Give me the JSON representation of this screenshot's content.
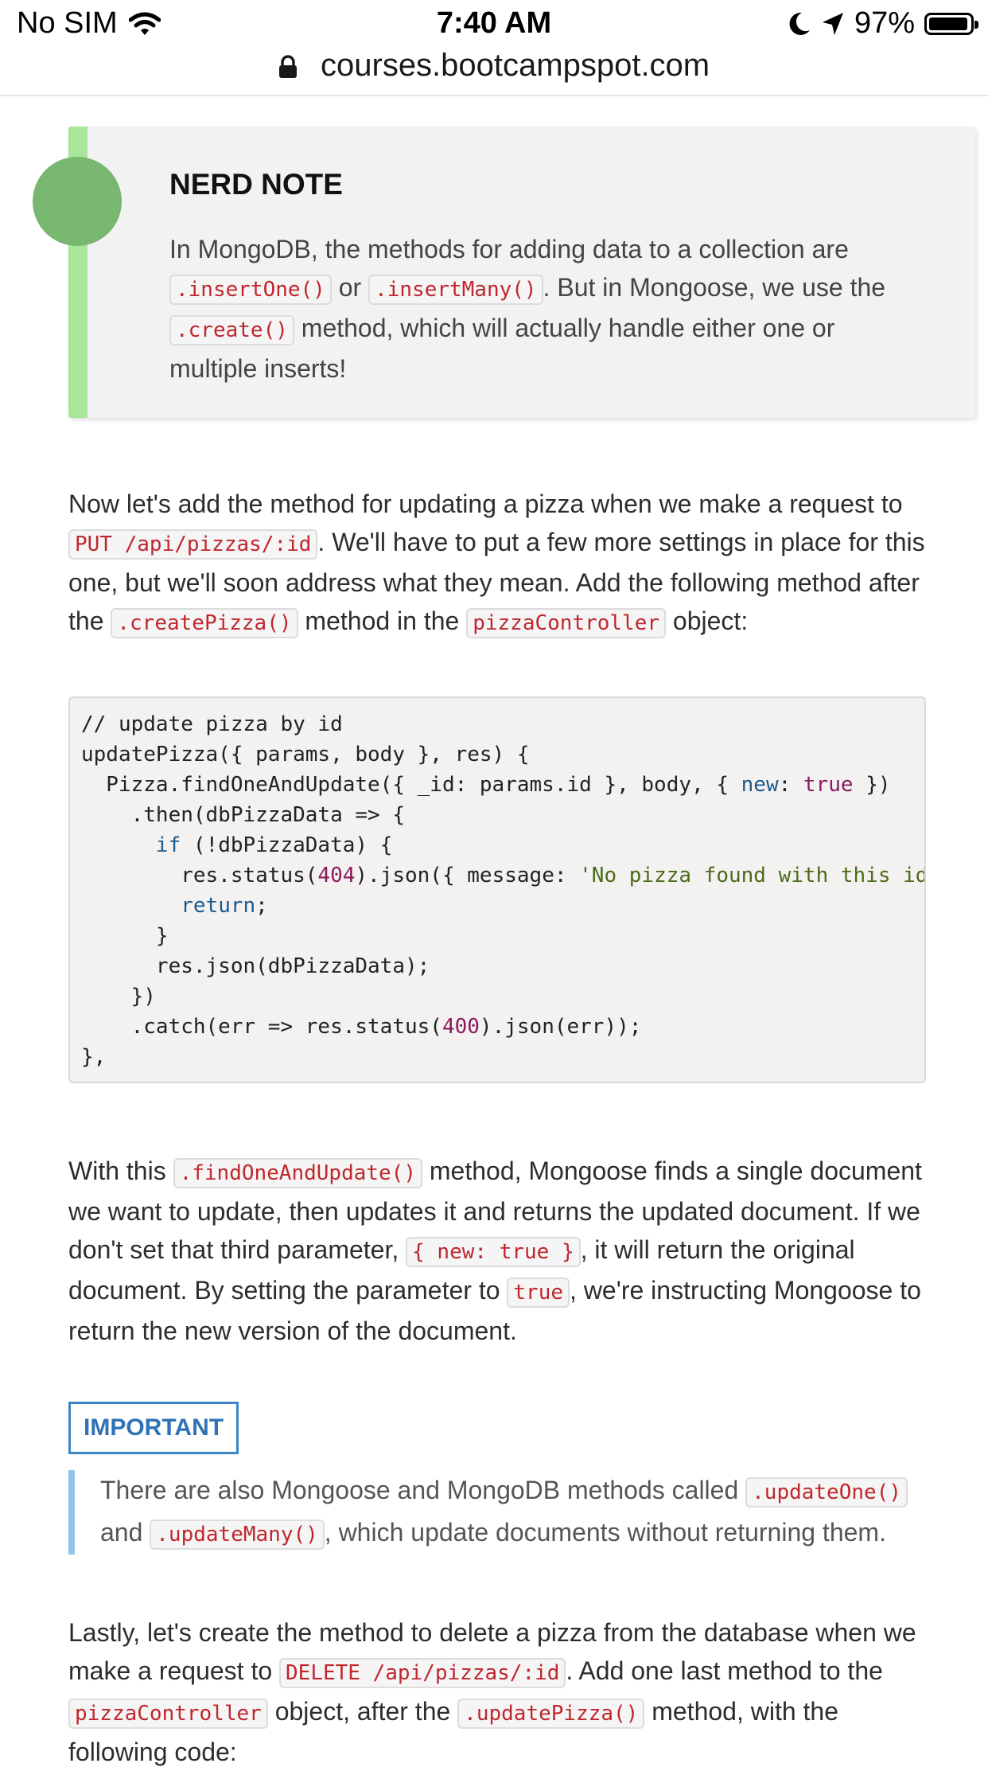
{
  "status": {
    "carrier": "No SIM",
    "time": "7:40 AM",
    "battery": "97%",
    "battery_level": 0.97
  },
  "browser": {
    "url": "courses.bootcampspot.com"
  },
  "nerd_note": {
    "title": "NERD NOTE",
    "t1": "In MongoDB, the methods for adding data to a collection are ",
    "c1": ".insertOne()",
    "t2": " or ",
    "c2": ".insertMany()",
    "t3": ". But in Mongoose, we use the ",
    "c3": ".create()",
    "t4": " method, which will actually handle either one or multiple inserts!"
  },
  "para1": {
    "t1": "Now let's add the method for updating a pizza when we make a request to ",
    "c1": "PUT /api/pizzas/:id",
    "t2": ". We'll have to put a few more settings in place for this one, but we'll soon address what they mean. Add the following method after the ",
    "c2": ".createPizza()",
    "t3": " method in the ",
    "c3": "pizzaController",
    "t4": " object:"
  },
  "code": {
    "l1": "// update pizza by id",
    "l2": "updatePizza({ params, body }, res) {",
    "l3a": "  Pizza.findOneAndUpdate({ _id: params.id }, body, { ",
    "l3b": "new",
    "l3c": ": ",
    "l3d": "true",
    "l3e": " })",
    "l4": "    .then(dbPizzaData => {",
    "l5a": "      ",
    "l5b": "if",
    "l5c": " (!dbPizzaData) {",
    "l6a": "        res.status(",
    "l6b": "404",
    "l6c": ").json({ message: ",
    "l6d": "'No pizza found with this id!'",
    "l6e": " });",
    "l7a": "        ",
    "l7b": "return",
    "l7c": ";",
    "l8": "      }",
    "l9": "      res.json(dbPizzaData);",
    "l10": "    })",
    "l11a": "    .catch(err => res.status(",
    "l11b": "400",
    "l11c": ").json(err));",
    "l12": "},"
  },
  "para2": {
    "t1": "With this ",
    "c1": ".findOneAndUpdate()",
    "t2": " method, Mongoose finds a single document we want to update, then updates it and returns the updated document. If we don't set that third parameter, ",
    "c2": "{ new: true }",
    "t3": ", it will return the original document. By setting the parameter to ",
    "c3": "true",
    "t4": ", we're instructing Mongoose to return the new version of the document."
  },
  "important": {
    "label": "IMPORTANT",
    "t1": "There are also Mongoose and MongoDB methods called ",
    "c1": ".updateOne()",
    "t2": " and ",
    "c2": ".updateMany()",
    "t3": ", which update documents without returning them."
  },
  "para3": {
    "t1": "Lastly, let's create the method to delete a pizza from the database when we make a request to ",
    "c1": "DELETE /api/pizzas/:id",
    "t2": ". Add one last method to the ",
    "c2": "pizzaController",
    "t3": " object, after the ",
    "c3": ".updatePizza()",
    "t4": " method, with the following code:"
  }
}
